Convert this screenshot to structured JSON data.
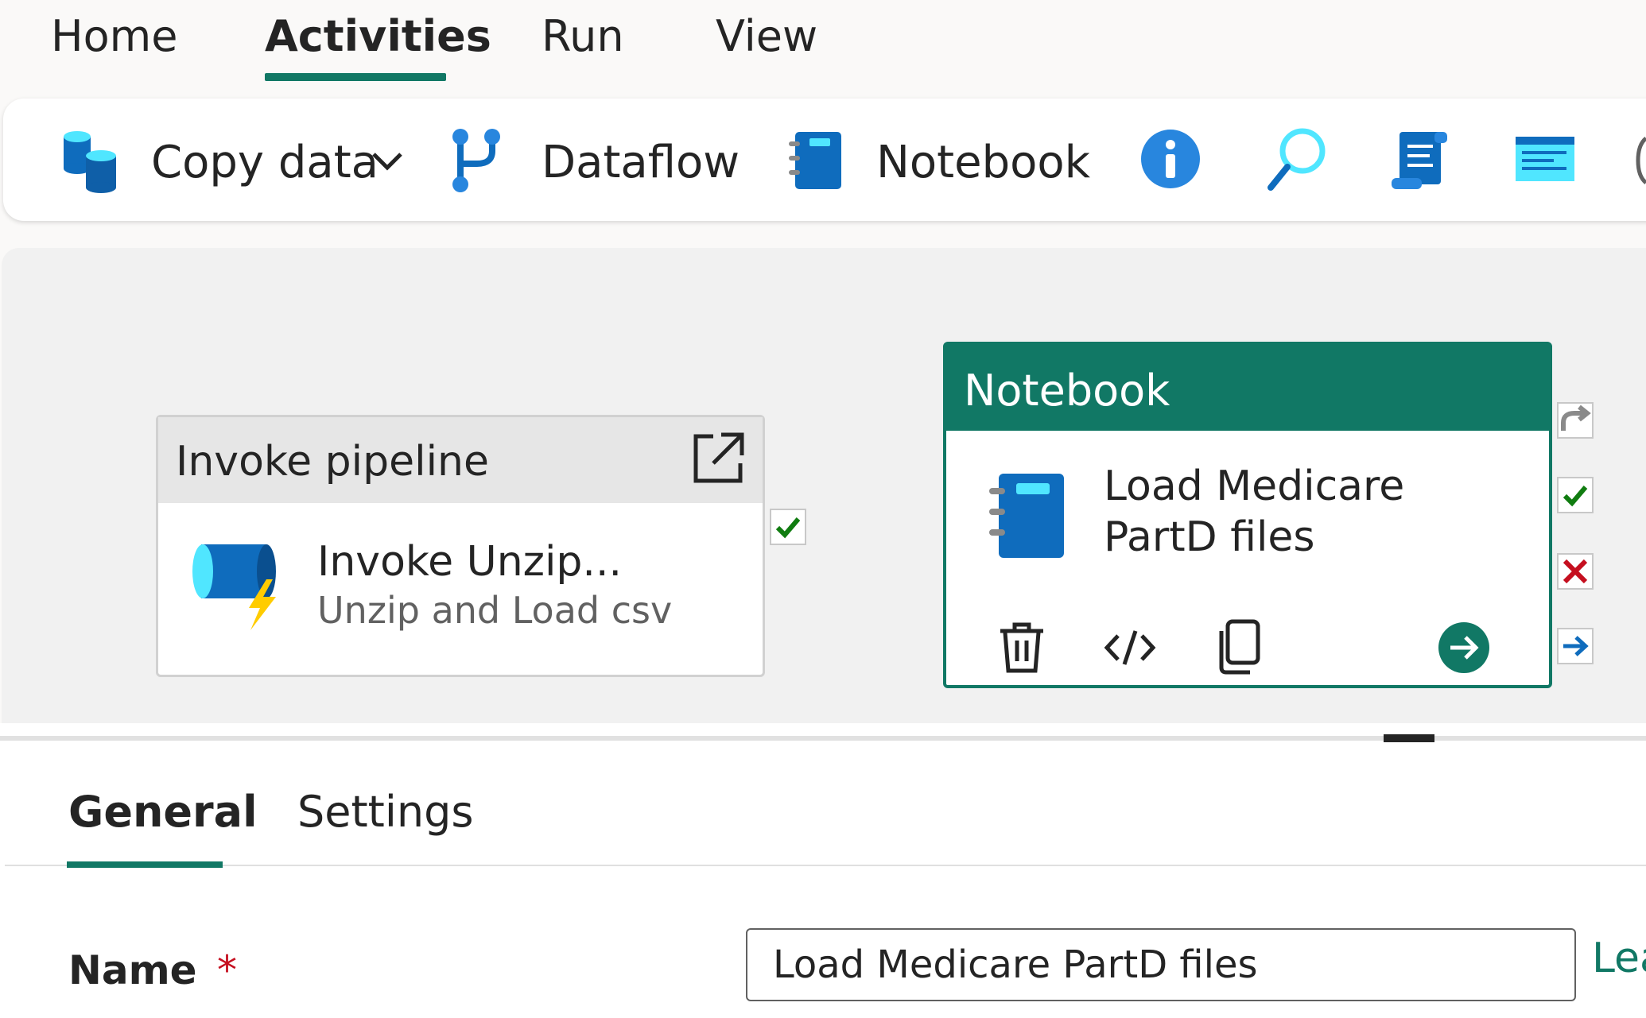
{
  "menu_tabs": [
    "Home",
    "Activities",
    "Run",
    "View"
  ],
  "active_menu_tab": "Activities",
  "toolbar": {
    "copy_data_label": "Copy data",
    "dataflow_label": "Dataflow",
    "notebook_label": "Notebook",
    "icons": [
      "copy-data-icon",
      "chevron-down-icon",
      "dataflow-icon",
      "notebook-icon",
      "info-icon",
      "lookup-icon",
      "script-icon",
      "set-variable-icon"
    ]
  },
  "canvas": {
    "invoke_card": {
      "header": "Invoke pipeline",
      "name": "Invoke Unzip...",
      "subtitle": "Unzip and Load csv"
    },
    "notebook_card": {
      "header": "Notebook",
      "name_line1": "Load Medicare",
      "name_line2": "PartD files"
    }
  },
  "bottom_panel": {
    "tabs": [
      "General",
      "Settings"
    ],
    "active_tab": "General",
    "name_label": "Name",
    "required_marker": "*",
    "name_value": "Load Medicare PartD files",
    "learn_more_partial": "Lea"
  },
  "colors": {
    "accent": "#117865",
    "success": "#107c10",
    "failure": "#c50f1f",
    "completion": "#0f6cbd",
    "icon_blue": "#0078d4"
  }
}
